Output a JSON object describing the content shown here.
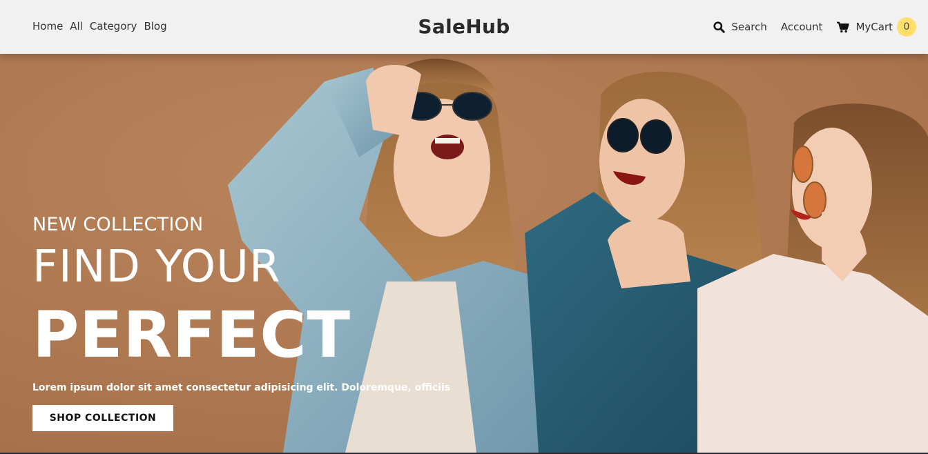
{
  "nav": {
    "links": [
      "Home",
      "All",
      "Category",
      "Blog"
    ],
    "brand": "SaleHub",
    "search_label": "Search",
    "account_label": "Account",
    "cart_label": "MyCart",
    "cart_count": "0"
  },
  "hero": {
    "kicker": "NEW COLLECTION",
    "line1": "FIND YOUR",
    "line2": "PERFECT",
    "description": "Lorem ipsum dolor sit amet consectetur adipisicing elit. Doloremque, officiis",
    "cta_label": "SHOP COLLECTION"
  },
  "colors": {
    "header_bg": "#f1f1f1",
    "hero_bg": "#b07a52",
    "badge": "#ffde6b",
    "text_dark": "#333333"
  }
}
